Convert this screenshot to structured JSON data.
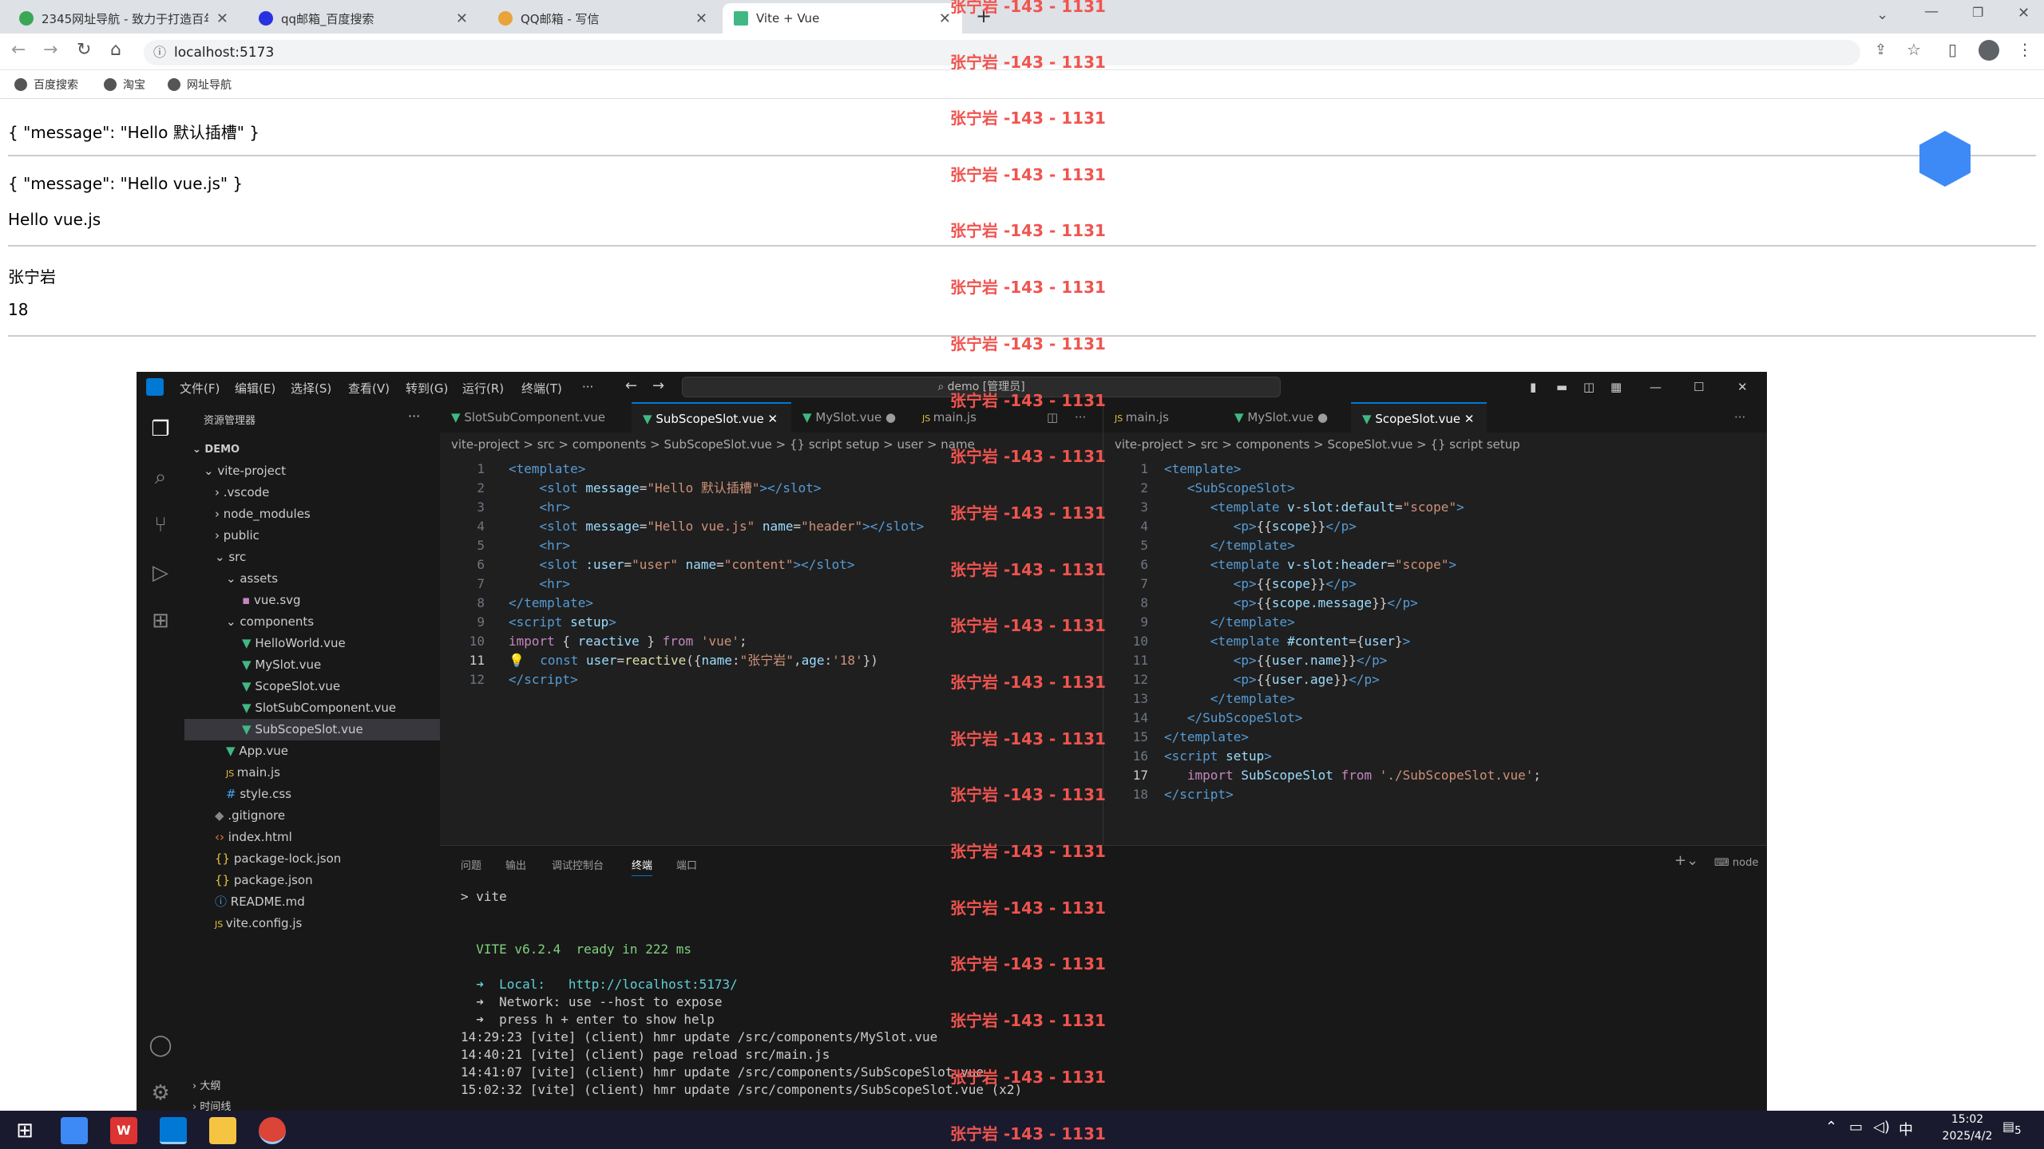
{
  "browser": {
    "tabs": [
      {
        "title": "2345网址导航 - 致力于打造百年"
      },
      {
        "title": "qq邮箱_百度搜索"
      },
      {
        "title": "QQ邮箱 - 写信"
      },
      {
        "title": "Vite + Vue"
      }
    ],
    "new_tab": "+",
    "address": "localhost:5173",
    "bookmarks": [
      {
        "label": "百度搜索"
      },
      {
        "label": "淘宝"
      },
      {
        "label": "网址导航"
      }
    ]
  },
  "page": {
    "lines": [
      "{ \"message\": \"Hello 默认插槽\" }",
      "{ \"message\": \"Hello vue.js\" }",
      "Hello vue.js",
      "张宁岩",
      "18"
    ]
  },
  "watermark": "张宁岩 -143 - 1131",
  "vscode": {
    "menu": [
      "文件(F)",
      "编辑(E)",
      "选择(S)",
      "查看(V)",
      "转到(G)",
      "运行(R)",
      "终端(T)",
      "···"
    ],
    "search": "demo [管理员]",
    "explorer_title": "资源管理器",
    "root": "DEMO",
    "tree": [
      "vite-project",
      ".vscode",
      "node_modules",
      "public",
      "src",
      "assets",
      "vue.svg",
      "components",
      "HelloWorld.vue",
      "MySlot.vue",
      "ScopeSlot.vue",
      "SlotSubComponent.vue",
      "SubScopeSlot.vue",
      "App.vue",
      "main.js",
      "style.css",
      ".gitignore",
      "index.html",
      "package-lock.json",
      "package.json",
      "README.md",
      "vite.config.js"
    ],
    "outline": "大纲",
    "timeline": "时间线",
    "ed1": {
      "tabs": [
        "SlotSubComponent.vue",
        "SubScopeSlot.vue",
        "MySlot.vue",
        "main.js"
      ],
      "crumb": "vite-project > src > components > SubScopeSlot.vue > {} script setup > user > name"
    },
    "ed2": {
      "tabs": [
        "main.js",
        "MySlot.vue",
        "ScopeSlot.vue"
      ],
      "crumb": "vite-project > src > components > ScopeSlot.vue > {} script setup"
    },
    "panel": {
      "tabs": [
        "问题",
        "输出",
        "调试控制台",
        "终端",
        "端口"
      ],
      "shell": "node",
      "term": [
        "> vite",
        "",
        "",
        "  VITE v6.2.4  ready in 222 ms",
        "",
        "  ➜  Local:   http://localhost:5173/",
        "  ➜  Network: use --host to expose",
        "  ➜  press h + enter to show help",
        "14:29:23 [vite] (client) hmr update /src/components/MySlot.vue",
        "14:40:21 [vite] (client) page reload src/main.js",
        "14:41:07 [vite] (client) hmr update /src/components/SubScopeSlot.vue",
        "15:02:32 [vite] (client) hmr update /src/components/SubScopeSlot.vue (x2)"
      ]
    }
  },
  "taskbar": {
    "time": "15:02",
    "date": "2025/4/2",
    "ime": "中",
    "notif": "5"
  }
}
